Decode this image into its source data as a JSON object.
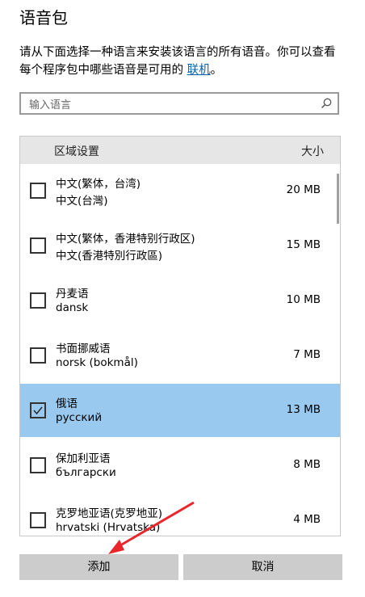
{
  "title": "语音包",
  "description": {
    "text": "请从下面选择一种语言来安装该语言的所有语音。你可以查看每个程序包中哪些语音是可用的 ",
    "link": "联机",
    "suffix": "。"
  },
  "search": {
    "placeholder": "输入语言",
    "value": ""
  },
  "list": {
    "headers": {
      "region": "区域设置",
      "size": "大小"
    },
    "items": [
      {
        "name": "中文(繁体，台湾)",
        "native": "中文(台灣)",
        "size": "20 MB",
        "checked": false
      },
      {
        "name": "中文(繁体，香港特别行政区)",
        "native": "中文(香港特別行政區)",
        "size": "15 MB",
        "checked": false
      },
      {
        "name": "丹麦语",
        "native": "dansk",
        "size": "10 MB",
        "checked": false
      },
      {
        "name": "书面挪威语",
        "native": "norsk (bokmål)",
        "size": "7 MB",
        "checked": false
      },
      {
        "name": "俄语",
        "native": "русский",
        "size": "13 MB",
        "checked": true
      },
      {
        "name": "保加利亚语",
        "native": "български",
        "size": "8 MB",
        "checked": false
      },
      {
        "name": "克罗地亚语(克罗地亚)",
        "native": "hrvatski (Hrvatska)",
        "size": "4 MB",
        "checked": false
      }
    ]
  },
  "buttons": {
    "add": "添加",
    "cancel": "取消"
  },
  "colors": {
    "selected_row": "#99c9ef",
    "link": "#0063b1",
    "arrow": "#e8262c"
  }
}
